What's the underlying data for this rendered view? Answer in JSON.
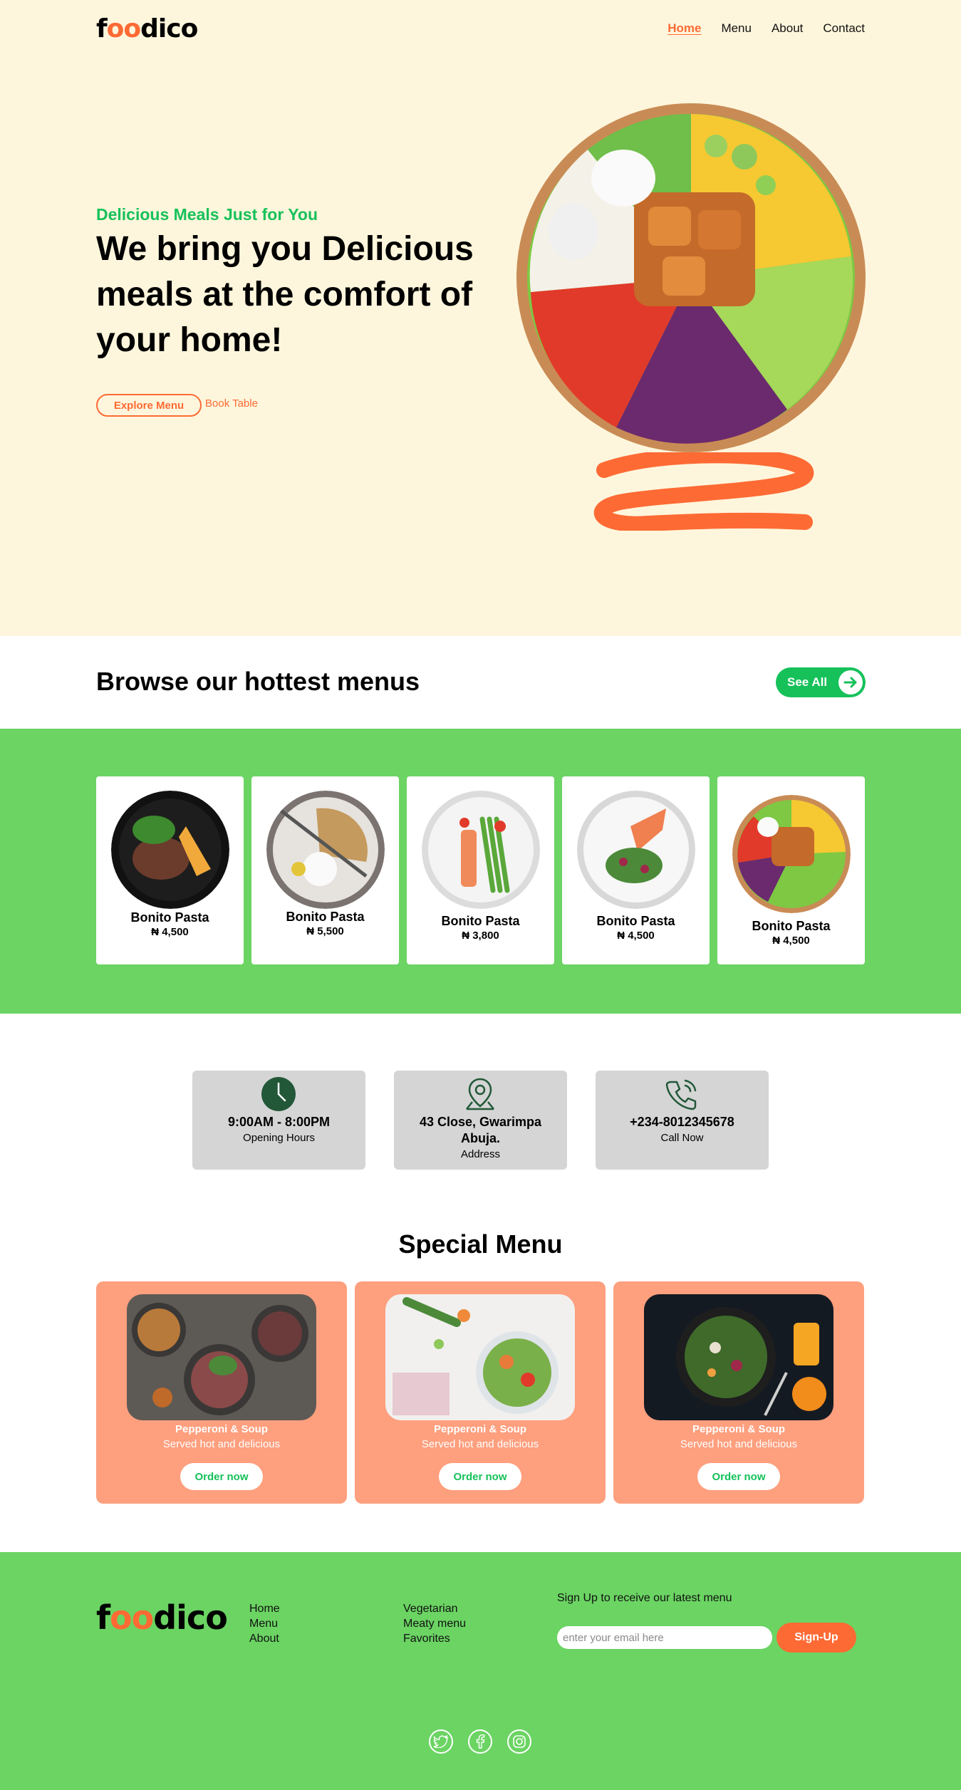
{
  "brand": {
    "logo_pre": "f",
    "logo_oo": "oo",
    "logo_post": "dico"
  },
  "nav": {
    "items": [
      {
        "label": "Home"
      },
      {
        "label": "Menu"
      },
      {
        "label": "About"
      },
      {
        "label": "Contact"
      }
    ],
    "active": "Home"
  },
  "hero": {
    "tagline": "Delicious Meals Just for You",
    "headline": "We bring you Delicious meals at the comfort of your home!",
    "explore_label": "Explore Menu",
    "book_label": "Book Table"
  },
  "browse": {
    "title": "Browse our hottest menus",
    "see_all_label": "See All",
    "items": [
      {
        "name": "Bonito Pasta",
        "price": "₦ 4,500"
      },
      {
        "name": "Bonito Pasta",
        "price": "₦ 5,500"
      },
      {
        "name": "Bonito Pasta",
        "price": "₦ 3,800"
      },
      {
        "name": "Bonito Pasta",
        "price": "₦ 4,500"
      },
      {
        "name": "Bonito Pasta",
        "price": "₦ 4,500"
      }
    ]
  },
  "info": {
    "hours": {
      "title": "9:00AM - 8:00PM",
      "sub": "Opening Hours",
      "icon": "clock-icon"
    },
    "address": {
      "title_line1": "43 Close, Gwarimpa",
      "title_line2": "Abuja.",
      "sub": "Address",
      "icon": "location-pin-icon"
    },
    "phone": {
      "title": "+234-8012345678",
      "sub": "Call Now",
      "icon": "phone-icon"
    }
  },
  "special": {
    "title": "Special Menu",
    "items": [
      {
        "name": "Pepperoni & Soup",
        "desc": "Served hot and delicious",
        "order_label": "Order now"
      },
      {
        "name": "Pepperoni & Soup",
        "desc": "Served hot and delicious",
        "order_label": "Order now"
      },
      {
        "name": "Pepperoni & Soup",
        "desc": "Served hot and delicious",
        "order_label": "Order now"
      }
    ]
  },
  "footer": {
    "links_col1": [
      "Home",
      "Menu",
      "About"
    ],
    "links_col2": [
      "Vegetarian",
      "Meaty menu",
      "Favorites"
    ],
    "signup_label": "Sign Up to receive our latest menu",
    "email_placeholder": "enter your email here",
    "signup_button": "Sign-Up",
    "social": [
      "twitter-icon",
      "facebook-icon",
      "instagram-icon"
    ]
  },
  "colors": {
    "accent_orange": "#fe6a34",
    "accent_green": "#16c15a",
    "band_green": "#6bd463",
    "hero_bg": "#fef6dc",
    "special_card": "#fe9f7e",
    "info_box": "#d5d5d5"
  }
}
